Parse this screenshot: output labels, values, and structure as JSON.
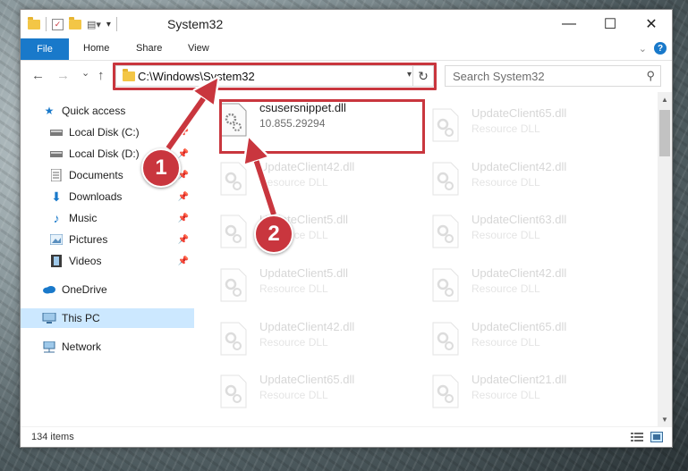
{
  "window": {
    "title": "System32",
    "minimize_label": "—",
    "maximize_label": "☐",
    "close_label": "✕"
  },
  "ribbon": {
    "file_tab": "File",
    "tabs": [
      "Home",
      "Share",
      "View"
    ],
    "help": "?"
  },
  "navigation": {
    "back": "←",
    "forward": "→",
    "recent": "⌄",
    "up": "↑",
    "address": "C:\\Windows\\System32",
    "search_placeholder": "Search System32"
  },
  "sidebar": {
    "items": [
      {
        "label": "Quick access",
        "icon": "star-icon",
        "pinned": false
      },
      {
        "label": "Local Disk (C:)",
        "icon": "drive-icon",
        "pinned": true
      },
      {
        "label": "Local Disk (D:)",
        "icon": "drive-icon",
        "pinned": true
      },
      {
        "label": "Documents",
        "icon": "documents-icon",
        "pinned": true
      },
      {
        "label": "Downloads",
        "icon": "downloads-icon",
        "pinned": true
      },
      {
        "label": "Music",
        "icon": "music-icon",
        "pinned": true
      },
      {
        "label": "Pictures",
        "icon": "pictures-icon",
        "pinned": true
      },
      {
        "label": "Videos",
        "icon": "videos-icon",
        "pinned": true
      },
      {
        "label": "OneDrive",
        "icon": "onedrive-icon",
        "pinned": false
      },
      {
        "label": "This PC",
        "icon": "computer-icon",
        "pinned": false,
        "selected": true
      },
      {
        "label": "Network",
        "icon": "network-icon",
        "pinned": false
      }
    ]
  },
  "files": [
    {
      "name": "csusersnippet.dll",
      "desc": "10.855.29294",
      "highlighted": true
    },
    {
      "name": "UpdateClient65.dll",
      "desc": "Resource DLL"
    },
    {
      "name": "UpdateClient42.dll",
      "desc": "Resource DLL"
    },
    {
      "name": "UpdateClient42.dll",
      "desc": "Resource DLL"
    },
    {
      "name": "UpdateClient5.dll",
      "desc": "Resource DLL"
    },
    {
      "name": "UpdateClient63.dll",
      "desc": "Resource DLL"
    },
    {
      "name": "UpdateClient5.dll",
      "desc": "Resource DLL"
    },
    {
      "name": "UpdateClient42.dll",
      "desc": "Resource DLL"
    },
    {
      "name": "UpdateClient42.dll",
      "desc": "Resource DLL"
    },
    {
      "name": "UpdateClient65.dll",
      "desc": "Resource DLL"
    },
    {
      "name": "UpdateClient65.dll",
      "desc": "Resource DLL"
    },
    {
      "name": "UpdateClient21.dll",
      "desc": "Resource DLL"
    }
  ],
  "status": {
    "item_count": "134 items"
  },
  "annotations": {
    "step1": "1",
    "step2": "2",
    "color": "#c9363e"
  }
}
